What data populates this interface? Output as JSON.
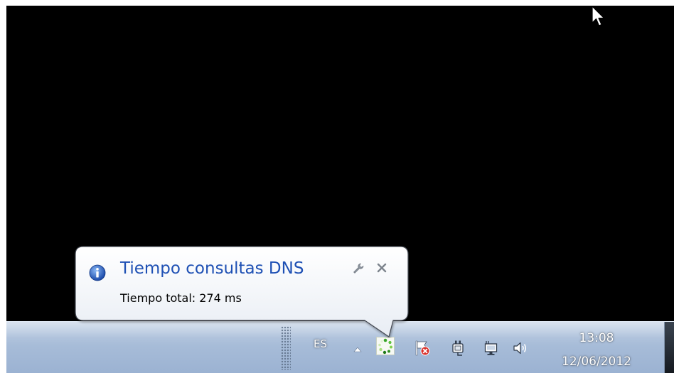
{
  "balloon": {
    "title": "Tiempo consultas DNS",
    "text": "Tiempo total: 274 ms",
    "icon": "info-icon"
  },
  "taskbar": {
    "language": "ES",
    "clock_time": "13:08",
    "clock_date": "12/06/2012",
    "tray_icons": [
      "dns-monitor-icon",
      "action-center-flag-icon",
      "power-icon",
      "network-icon",
      "volume-icon"
    ]
  },
  "colors": {
    "balloon_title": "#1e50b4",
    "desktop": "#000000",
    "taskbar": "#a7bcd8"
  }
}
